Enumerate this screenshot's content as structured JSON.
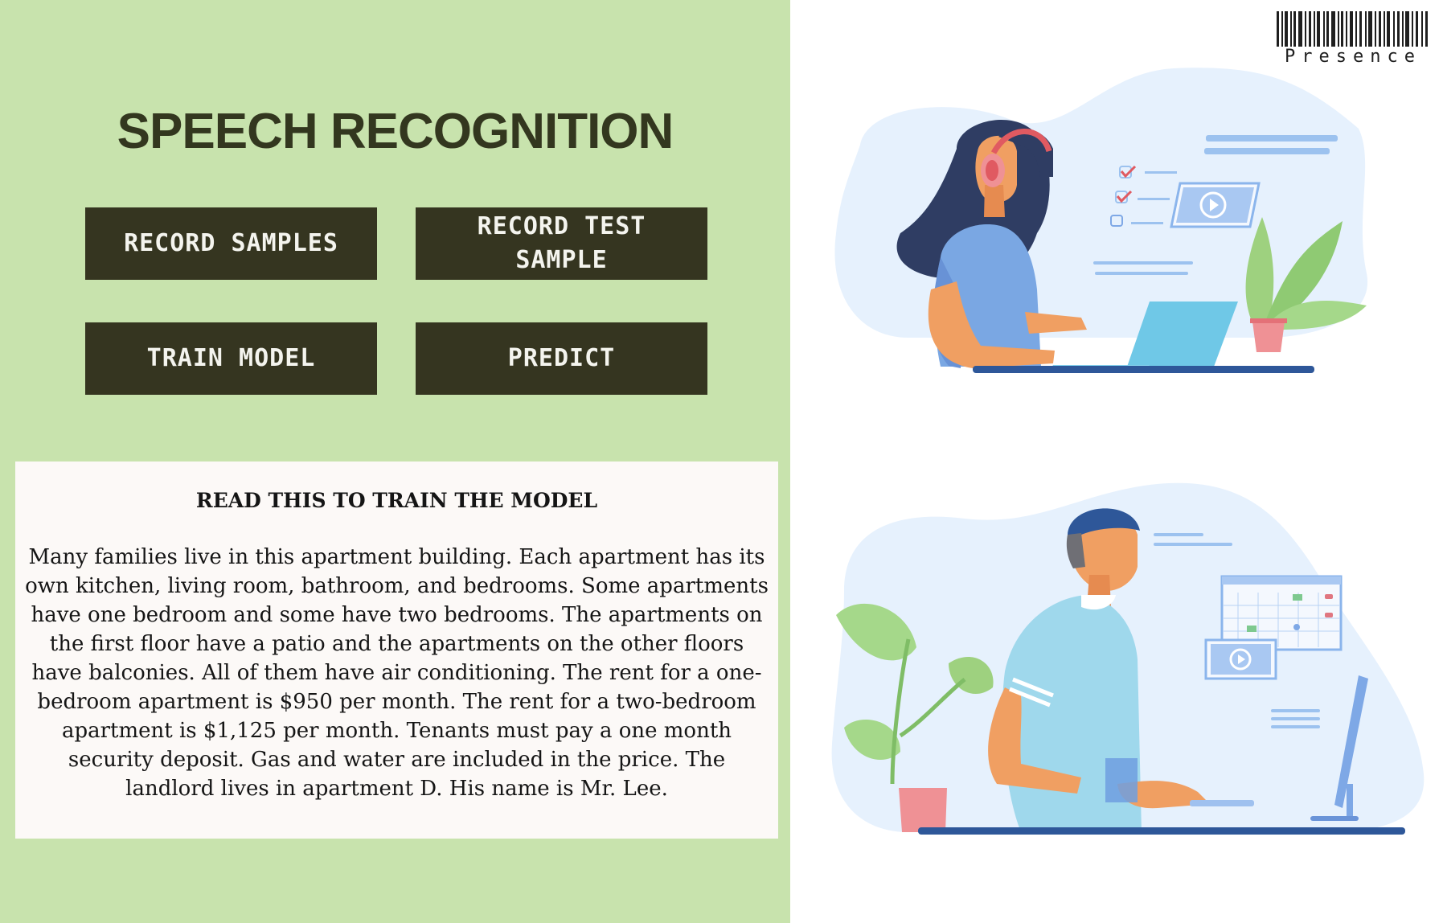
{
  "app": {
    "title": "SPEECH RECOGNITION"
  },
  "buttons": {
    "record_samples": "RECORD SAMPLES",
    "record_test_sample": "RECORD TEST SAMPLE",
    "train_model": "TRAIN MODEL",
    "predict": "PREDICT"
  },
  "passage": {
    "heading": "READ THIS TO TRAIN THE MODEL",
    "text": "Many families live in this apartment building. Each apartment has its own kitchen, living room, bathroom, and bedrooms. Some apartments have one bedroom and some have two bedrooms. The apartments on the first floor have a patio and the apartments on the other floors have balconies. All of them have air conditioning. The rent for a one-bedroom apartment is $950 per month. The rent for a two-bedroom apartment is $1,125 per month. Tenants must pay a one month security deposit. Gas and water are included in the price. The landlord lives in apartment D. His name is Mr. Lee."
  },
  "logo": {
    "wordmark": "Presence",
    "icon": "barcode-icon"
  },
  "illustrations": [
    {
      "icon": "woman-with-headphones-laptop-illustration"
    },
    {
      "icon": "man-at-computer-illustration"
    }
  ],
  "colors": {
    "left_panel_bg": "#c8e3ad",
    "button_bg": "#353520",
    "button_text": "#f4f4ee",
    "title_text": "#33371f",
    "card_bg": "#fcf9f7",
    "illustration_blob": "#e6f1fd"
  }
}
